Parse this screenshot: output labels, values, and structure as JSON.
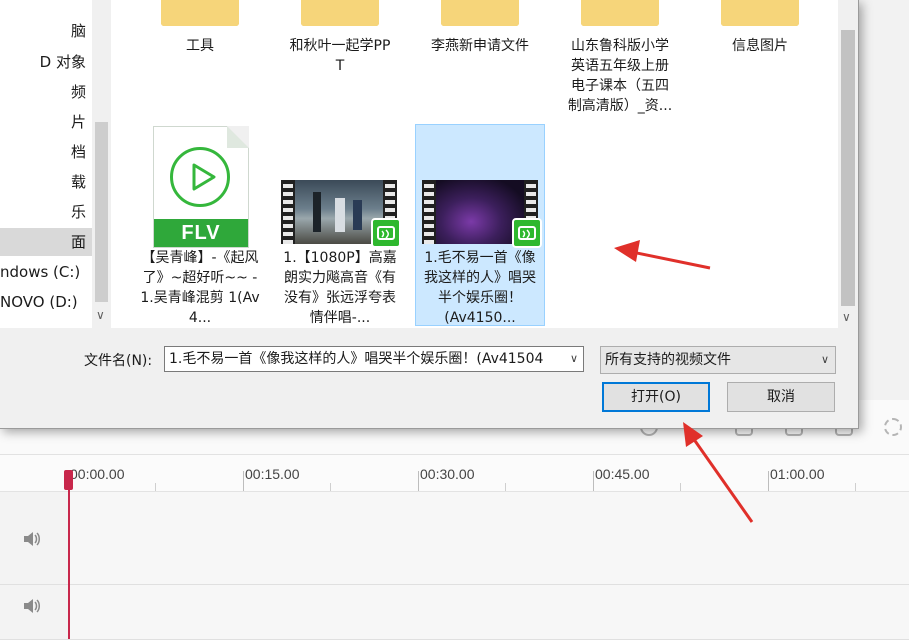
{
  "nav": {
    "items": [
      {
        "label": "脑"
      },
      {
        "label": "D 对象"
      },
      {
        "label": "频"
      },
      {
        "label": "片"
      },
      {
        "label": "档"
      },
      {
        "label": "载"
      },
      {
        "label": "乐"
      },
      {
        "label": "面",
        "selected": true
      },
      {
        "label": "ndows (C:)"
      },
      {
        "label": "NOVO (D:)"
      }
    ]
  },
  "files": {
    "folders": [
      {
        "label": "工具",
        "icon": "folder-icon"
      },
      {
        "label": "和秋叶一起学PPT",
        "icon": "folder-icon"
      },
      {
        "label": "李燕新申请文件",
        "icon": "folder-icon"
      },
      {
        "label": "山东鲁科版小学英语五年级上册电子课本（五四制高清版）_资...",
        "icon": "folder-icon"
      },
      {
        "label": "信息图片",
        "icon": "folder-icon"
      }
    ],
    "videos": [
      {
        "label": "【吴青峰】-《起风了》~超好听~~ - 1.吴青峰混剪 1(Av4...",
        "icon": "flv-file-icon",
        "badge": "FLV"
      },
      {
        "label": "1.【1080P】高嘉朗实力飚高音《有没有》张远浮夸表情伴唱-...",
        "icon": "video-thumbnail"
      },
      {
        "label": "1.毛不易一首《像我这样的人》唱哭半个娱乐圈！(Av4150...",
        "icon": "video-thumbnail",
        "selected": true
      }
    ]
  },
  "form": {
    "filename_label": "文件名(N):",
    "filename_value": "1.毛不易一首《像我这样的人》唱哭半个娱乐圈！(Av41504",
    "filter_value": "所有支持的视频文件",
    "open_label": "打开(O)",
    "cancel_label": "取消"
  },
  "timeline": {
    "ticks": [
      "00:00.00",
      "00:15.00",
      "00:30.00",
      "00:45.00",
      "01:00.00"
    ]
  },
  "colors": {
    "accent": "#0078d7",
    "playhead": "#c8274b",
    "selection": "#cce8ff",
    "folder": "#f6d57a",
    "flv_green": "#2fa83a",
    "annotation_arrow": "#e0302a"
  }
}
